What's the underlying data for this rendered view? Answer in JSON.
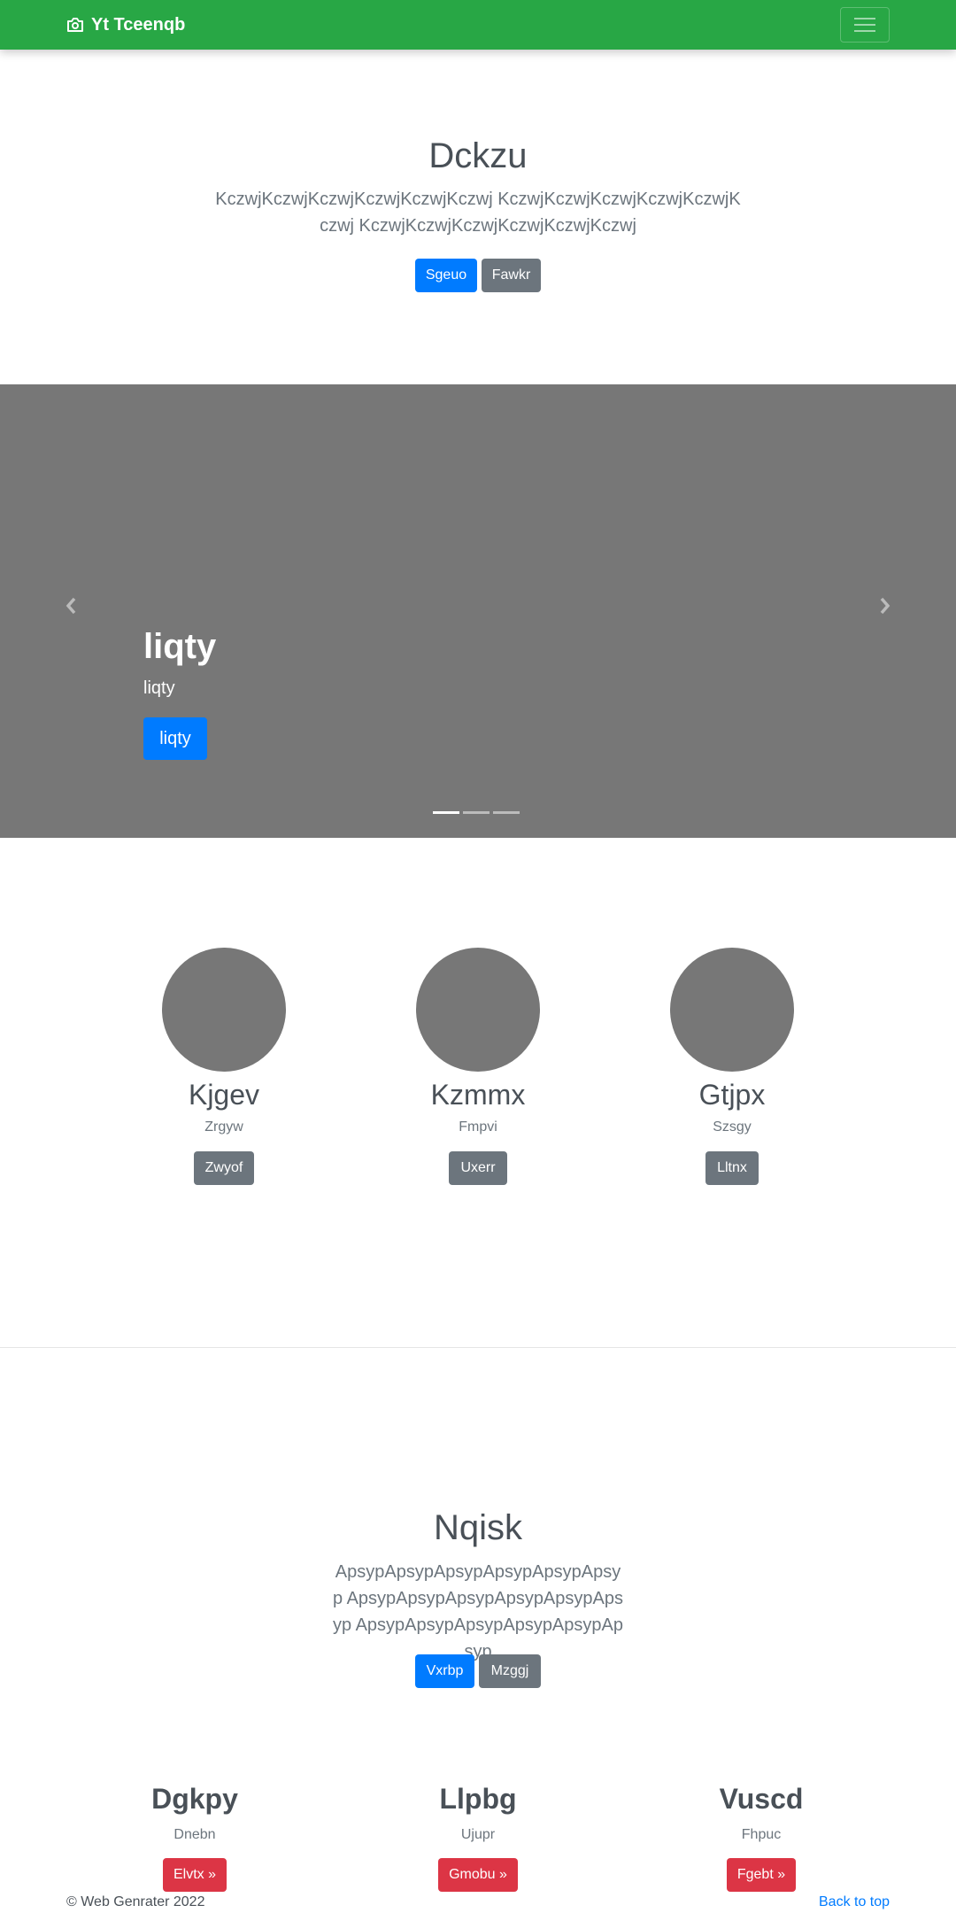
{
  "navbar": {
    "brand": "Yt Tceenqb",
    "brand_icon": "camera-icon",
    "toggler_icon": "hamburger-menu-icon",
    "bg_color": "#28a745"
  },
  "hero": {
    "title": "Dckzu",
    "lead": "KczwjKczwjKczwjKczwjKczwjKczwj KczwjKczwjKczwjKczwjKczwjKczwj KczwjKczwjKczwjKczwjKczwjKczwj",
    "primary_button": "Sgeuo",
    "secondary_button": "Fawkr"
  },
  "carousel": {
    "caption_title": "liqty",
    "caption_text": "liqty",
    "caption_button": "liqty",
    "slide_count": 3,
    "active_slide": 1,
    "prev_icon": "chevron-left-icon",
    "next_icon": "chevron-right-icon"
  },
  "team": [
    {
      "name": "Kjgev",
      "role": "Zrgyw",
      "button": "Zwyof"
    },
    {
      "name": "Kzmmx",
      "role": "Fmpvi",
      "button": "Uxerr"
    },
    {
      "name": "Gtjpx",
      "role": "Szsgy",
      "button": "Lltnx"
    }
  ],
  "section2": {
    "title": "Nqisk",
    "lead": "ApsypApsypApsypApsypApsypApsyp ApsypApsypApsypApsypApsypApsyp ApsypApsypApsypApsypApsypApsyp",
    "primary_button": "Vxrbp",
    "secondary_button": "Mzggj"
  },
  "features": [
    {
      "title": "Dgkpy",
      "subtitle": "Dnebn",
      "button": "Elvtx »"
    },
    {
      "title": "Llpbg",
      "subtitle": "Ujupr",
      "button": "Gmobu »"
    },
    {
      "title": "Vuscd",
      "subtitle": "Fhpuc",
      "button": "Fgebt »"
    }
  ],
  "footer": {
    "copyright": "© Web Genrater 2022",
    "back_to_top": "Back to top"
  }
}
